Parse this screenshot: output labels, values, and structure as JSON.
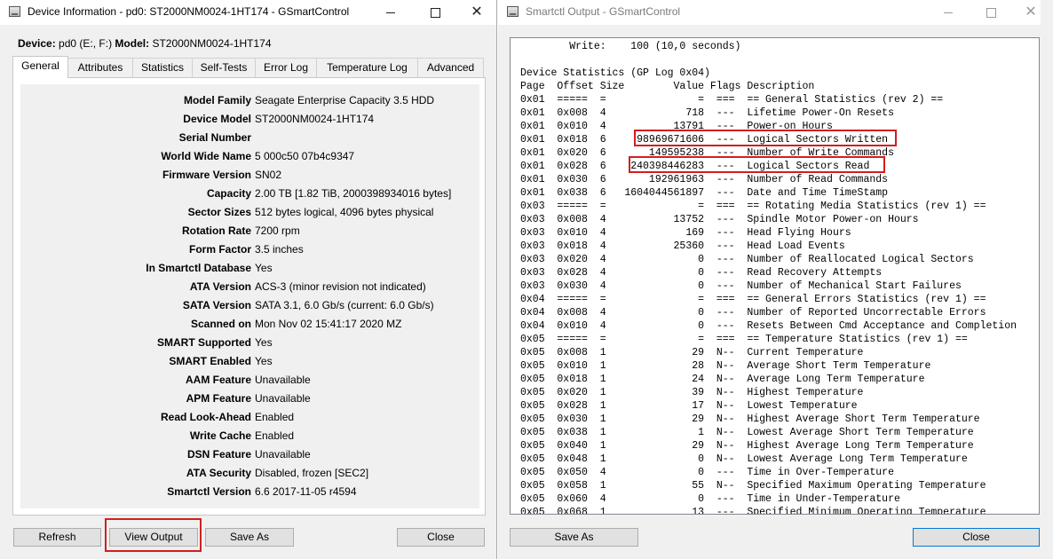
{
  "device_window": {
    "title": "Device Information - pd0: ST2000NM0024-1HT174 - GSmartControl",
    "controls": {
      "minimize": "",
      "maximize": "",
      "close": "✕"
    },
    "device_label": "Device:",
    "device_value": "pd0 (E:, F:)",
    "model_label": "Model:",
    "model_value": "ST2000NM0024-1HT174",
    "tabs": [
      "General",
      "Attributes",
      "Statistics",
      "Self-Tests",
      "Error Log",
      "Temperature Log",
      "Advanced"
    ],
    "active_tab": "General",
    "info": [
      {
        "label": "Model Family",
        "value": "Seagate Enterprise Capacity 3.5 HDD"
      },
      {
        "label": "Device Model",
        "value": "ST2000NM0024-1HT174"
      },
      {
        "label": "Serial Number",
        "value": ""
      },
      {
        "label": "World Wide Name",
        "value": "5 000c50 07b4c9347"
      },
      {
        "label": "Firmware Version",
        "value": "SN02"
      },
      {
        "label": "Capacity",
        "value": "2.00 TB [1.82 TiB, 2000398934016 bytes]"
      },
      {
        "label": "Sector Sizes",
        "value": "512 bytes logical, 4096 bytes physical"
      },
      {
        "label": "Rotation Rate",
        "value": "7200 rpm"
      },
      {
        "label": "Form Factor",
        "value": "3.5 inches"
      },
      {
        "label": "In Smartctl Database",
        "value": "Yes"
      },
      {
        "label": "ATA Version",
        "value": "ACS-3 (minor revision not indicated)"
      },
      {
        "label": "SATA Version",
        "value": "SATA 3.1, 6.0 Gb/s (current: 6.0 Gb/s)"
      },
      {
        "label": "Scanned on",
        "value": "Mon Nov 02 15:41:17 2020 MZ"
      },
      {
        "label": "SMART Supported",
        "value": "Yes"
      },
      {
        "label": "SMART Enabled",
        "value": "Yes"
      },
      {
        "label": "AAM Feature",
        "value": "Unavailable"
      },
      {
        "label": "APM Feature",
        "value": "Unavailable"
      },
      {
        "label": "Read Look-Ahead",
        "value": "Enabled"
      },
      {
        "label": "Write Cache",
        "value": "Enabled"
      },
      {
        "label": "DSN Feature",
        "value": "Unavailable"
      },
      {
        "label": "ATA Security",
        "value": "Disabled, frozen [SEC2]"
      },
      {
        "label": "Smartctl Version",
        "value": "6.6 2017-11-05 r4594"
      }
    ],
    "buttons": {
      "refresh": "Refresh",
      "view_output": "View Output",
      "save_as": "Save As",
      "close": "Close"
    },
    "highlight_color": "#d21e1e"
  },
  "output_window": {
    "title": "Smartctl Output - GSmartControl",
    "controls": {
      "minimize": "",
      "maximize": "",
      "close": "✕"
    },
    "lines": [
      "        Write:    100 (10,0 seconds)",
      "",
      "Device Statistics (GP Log 0x04)",
      "Page  Offset Size        Value Flags Description",
      "0x01  =====  =               =  ===  == General Statistics (rev 2) ==",
      "0x01  0x008  4             718  ---  Lifetime Power-On Resets",
      "0x01  0x010  4           13791  ---  Power-on Hours",
      "0x01  0x018  6     98969671606  ---  Logical Sectors Written",
      "0x01  0x020  6       149595238  ---  Number of Write Commands",
      "0x01  0x028  6    240398446283  ---  Logical Sectors Read",
      "0x01  0x030  6       192961963  ---  Number of Read Commands",
      "0x01  0x038  6   1604044561897  ---  Date and Time TimeStamp",
      "0x03  =====  =               =  ===  == Rotating Media Statistics (rev 1) ==",
      "0x03  0x008  4           13752  ---  Spindle Motor Power-on Hours",
      "0x03  0x010  4             169  ---  Head Flying Hours",
      "0x03  0x018  4           25360  ---  Head Load Events",
      "0x03  0x020  4               0  ---  Number of Reallocated Logical Sectors",
      "0x03  0x028  4               0  ---  Read Recovery Attempts",
      "0x03  0x030  4               0  ---  Number of Mechanical Start Failures",
      "0x04  =====  =               =  ===  == General Errors Statistics (rev 1) ==",
      "0x04  0x008  4               0  ---  Number of Reported Uncorrectable Errors",
      "0x04  0x010  4               0  ---  Resets Between Cmd Acceptance and Completion",
      "0x05  =====  =               =  ===  == Temperature Statistics (rev 1) ==",
      "0x05  0x008  1              29  N--  Current Temperature",
      "0x05  0x010  1              28  N--  Average Short Term Temperature",
      "0x05  0x018  1              24  N--  Average Long Term Temperature",
      "0x05  0x020  1              39  N--  Highest Temperature",
      "0x05  0x028  1              17  N--  Lowest Temperature",
      "0x05  0x030  1              29  N--  Highest Average Short Term Temperature",
      "0x05  0x038  1               1  N--  Lowest Average Short Term Temperature",
      "0x05  0x040  1              29  N--  Highest Average Long Term Temperature",
      "0x05  0x048  1               0  N--  Lowest Average Long Term Temperature",
      "0x05  0x050  4               0  ---  Time in Over-Temperature",
      "0x05  0x058  1              55  N--  Specified Maximum Operating Temperature",
      "0x05  0x060  4               0  ---  Time in Under-Temperature",
      "0x05  0x068  1              13  ---  Specified Minimum Operating Temperature"
    ],
    "buttons": {
      "save_as": "Save As",
      "close": "Close"
    }
  }
}
